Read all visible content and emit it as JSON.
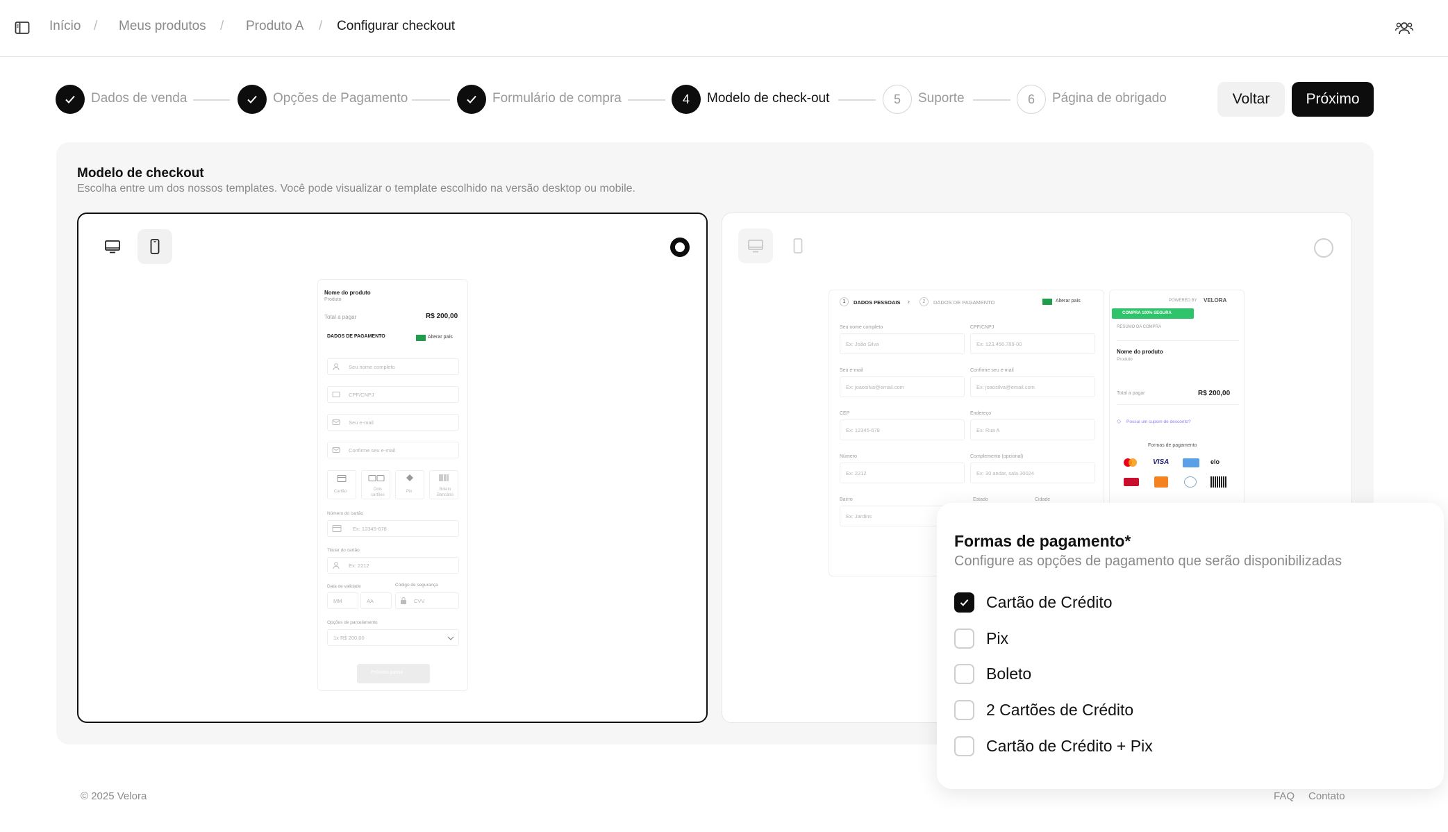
{
  "breadcrumb": {
    "items": [
      "Início",
      "Meus produtos",
      "Produto A"
    ],
    "current": "Configurar checkout",
    "separator": "/"
  },
  "stepper": {
    "steps": [
      {
        "number": "",
        "label": "Dados de venda",
        "state": "done"
      },
      {
        "number": "",
        "label": "Opções de Pagamento",
        "state": "done"
      },
      {
        "number": "",
        "label": "Formulário de compra",
        "state": "done"
      },
      {
        "number": "4",
        "label": "Modelo de check-out",
        "state": "active"
      },
      {
        "number": "5",
        "label": "Suporte",
        "state": "todo"
      },
      {
        "number": "6",
        "label": "Página de obrigado",
        "state": "todo"
      }
    ],
    "back_label": "Voltar",
    "next_label": "Próximo"
  },
  "section": {
    "title": "Modelo de checkout",
    "subtitle": "Escolha entre um dos nossos templates. Você pode visualizar o template escolhido na versão desktop ou mobile."
  },
  "mobile_preview": {
    "product_name": "Nome do produto",
    "product_sub": "Produto",
    "total_label": "Total a pagar",
    "total_value": "R$ 200,00",
    "payment_heading": "DADOS DE PAGAMENTO",
    "change_country": "Alterar país",
    "fields": [
      "Seu nome completo",
      "CPF/CNPJ",
      "Seu e-mail",
      "Confirme seu e-mail"
    ],
    "methods": [
      "Cartão",
      "Dois cartões",
      "Pix",
      "Boleto Bancário"
    ],
    "card_number_label": "Número do cartão",
    "card_number_ph": "Ex: 12345-678",
    "holder_label": "Titular do cartão",
    "holder_ph": "Ex: 2212",
    "expiry_label": "Data de validade",
    "cvv_label": "Código de segurança",
    "mm": "MM",
    "aa": "AA",
    "cvv": "CVV",
    "installments_label": "Opções de parcelamento",
    "installments_value": "1x R$ 200,00",
    "next_step": "Próximo passo"
  },
  "desktop_preview": {
    "step1": "DADOS PESSOAIS",
    "step2": "DADOS DE PAGAMENTO",
    "change_country": "Alterar país",
    "fields": [
      {
        "label": "Seu nome completo",
        "ph": "Ex: João Silva"
      },
      {
        "label": "CPF/CNPJ",
        "ph": "Ex: 123.456.789-00"
      },
      {
        "label": "Seu e-mail",
        "ph": "Ex: joaosilva@email.com"
      },
      {
        "label": "Confirme seu e-mail",
        "ph": "Ex: joaosilva@email.com"
      },
      {
        "label": "CEP",
        "ph": "Ex: 12345-678"
      },
      {
        "label": "Endereço",
        "ph": "Ex: Rua A"
      },
      {
        "label": "Número",
        "ph": "Ex: 2212"
      },
      {
        "label": "Complemento (opcional)",
        "ph": "Ex: 30 andar, sala 30024"
      },
      {
        "label": "Bairro",
        "ph": "Ex: Jardins"
      }
    ],
    "state_label": "Estado",
    "city_label": "Cidade",
    "powered_by": "POWERED BY",
    "brand": "VELORA",
    "secure_badge": "COMPRA 100% SEGURA",
    "summary_heading": "RESUMO DA COMPRA",
    "product_name": "Nome do produto",
    "product_sub": "Produto",
    "total_label": "Total a pagar",
    "total_value": "R$ 200,00",
    "coupon": "Possui um cupom de desconto?",
    "payment_methods_heading": "Formas de pagamento",
    "logos": [
      "VISA",
      "elo"
    ]
  },
  "popover": {
    "title": "Formas de pagamento*",
    "subtitle": "Configure as opções de pagamento que serão disponibilizadas",
    "options": [
      {
        "label": "Cartão de Crédito",
        "checked": true
      },
      {
        "label": "Pix",
        "checked": false
      },
      {
        "label": "Boleto",
        "checked": false
      },
      {
        "label": "2 Cartões de Crédito",
        "checked": false
      },
      {
        "label": "Cartão de Crédito + Pix",
        "checked": false
      }
    ]
  },
  "footer": {
    "copyright": "© 2025 Velora",
    "faq": "FAQ",
    "contact": "Contato"
  },
  "colors": {
    "primary": "#0d0d0d",
    "muted": "#8a8a8a",
    "panel_bg": "#f6f6f6",
    "secure_green": "#2fc46b",
    "accent_purple": "#8b7cf6"
  }
}
